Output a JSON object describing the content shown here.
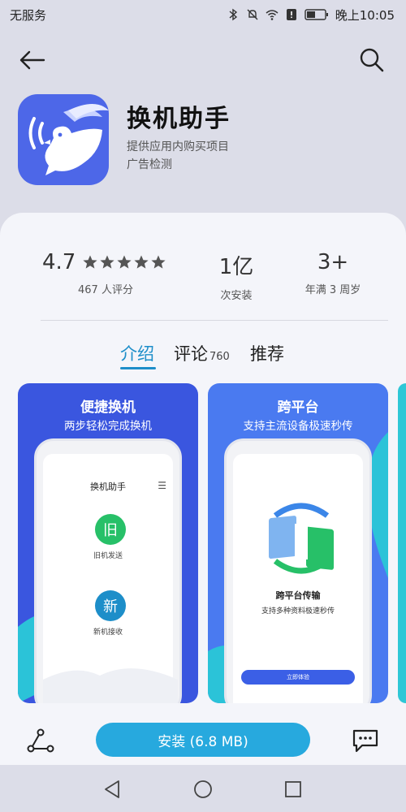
{
  "status": {
    "carrier": "无服务",
    "time": "晚上10:05"
  },
  "app": {
    "name": "换机助手",
    "line1": "提供应用内购买项目",
    "line2": "广告检测"
  },
  "stats": {
    "rating": "4.7",
    "rating_stars": 5,
    "rating_count": "467 人评分",
    "installs": "1亿",
    "installs_label": "次安装",
    "age": "3+",
    "age_label": "年满 3 周岁"
  },
  "tabs": [
    {
      "label": "介绍",
      "count": ""
    },
    {
      "label": "评论",
      "count": "760"
    },
    {
      "label": "推荐",
      "count": ""
    }
  ],
  "screenshots": [
    {
      "title": "便捷换机",
      "subtitle": "两步轻松完成换机",
      "header": "换机助手",
      "old_label": "旧",
      "old_caption": "旧机发送",
      "new_label": "新",
      "new_caption": "新机接收"
    },
    {
      "title": "跨平台",
      "subtitle": "支持主流设备极速秒传",
      "heading": "跨平台传输",
      "caption": "支持多种资料极速秒传",
      "button": "立即体验"
    }
  ],
  "install_button": "安装 (6.8 MB)",
  "colors": {
    "accent": "#1d8ec9",
    "install": "#27a9de",
    "icon_bg": "#4d67e8",
    "green": "#27c068"
  }
}
